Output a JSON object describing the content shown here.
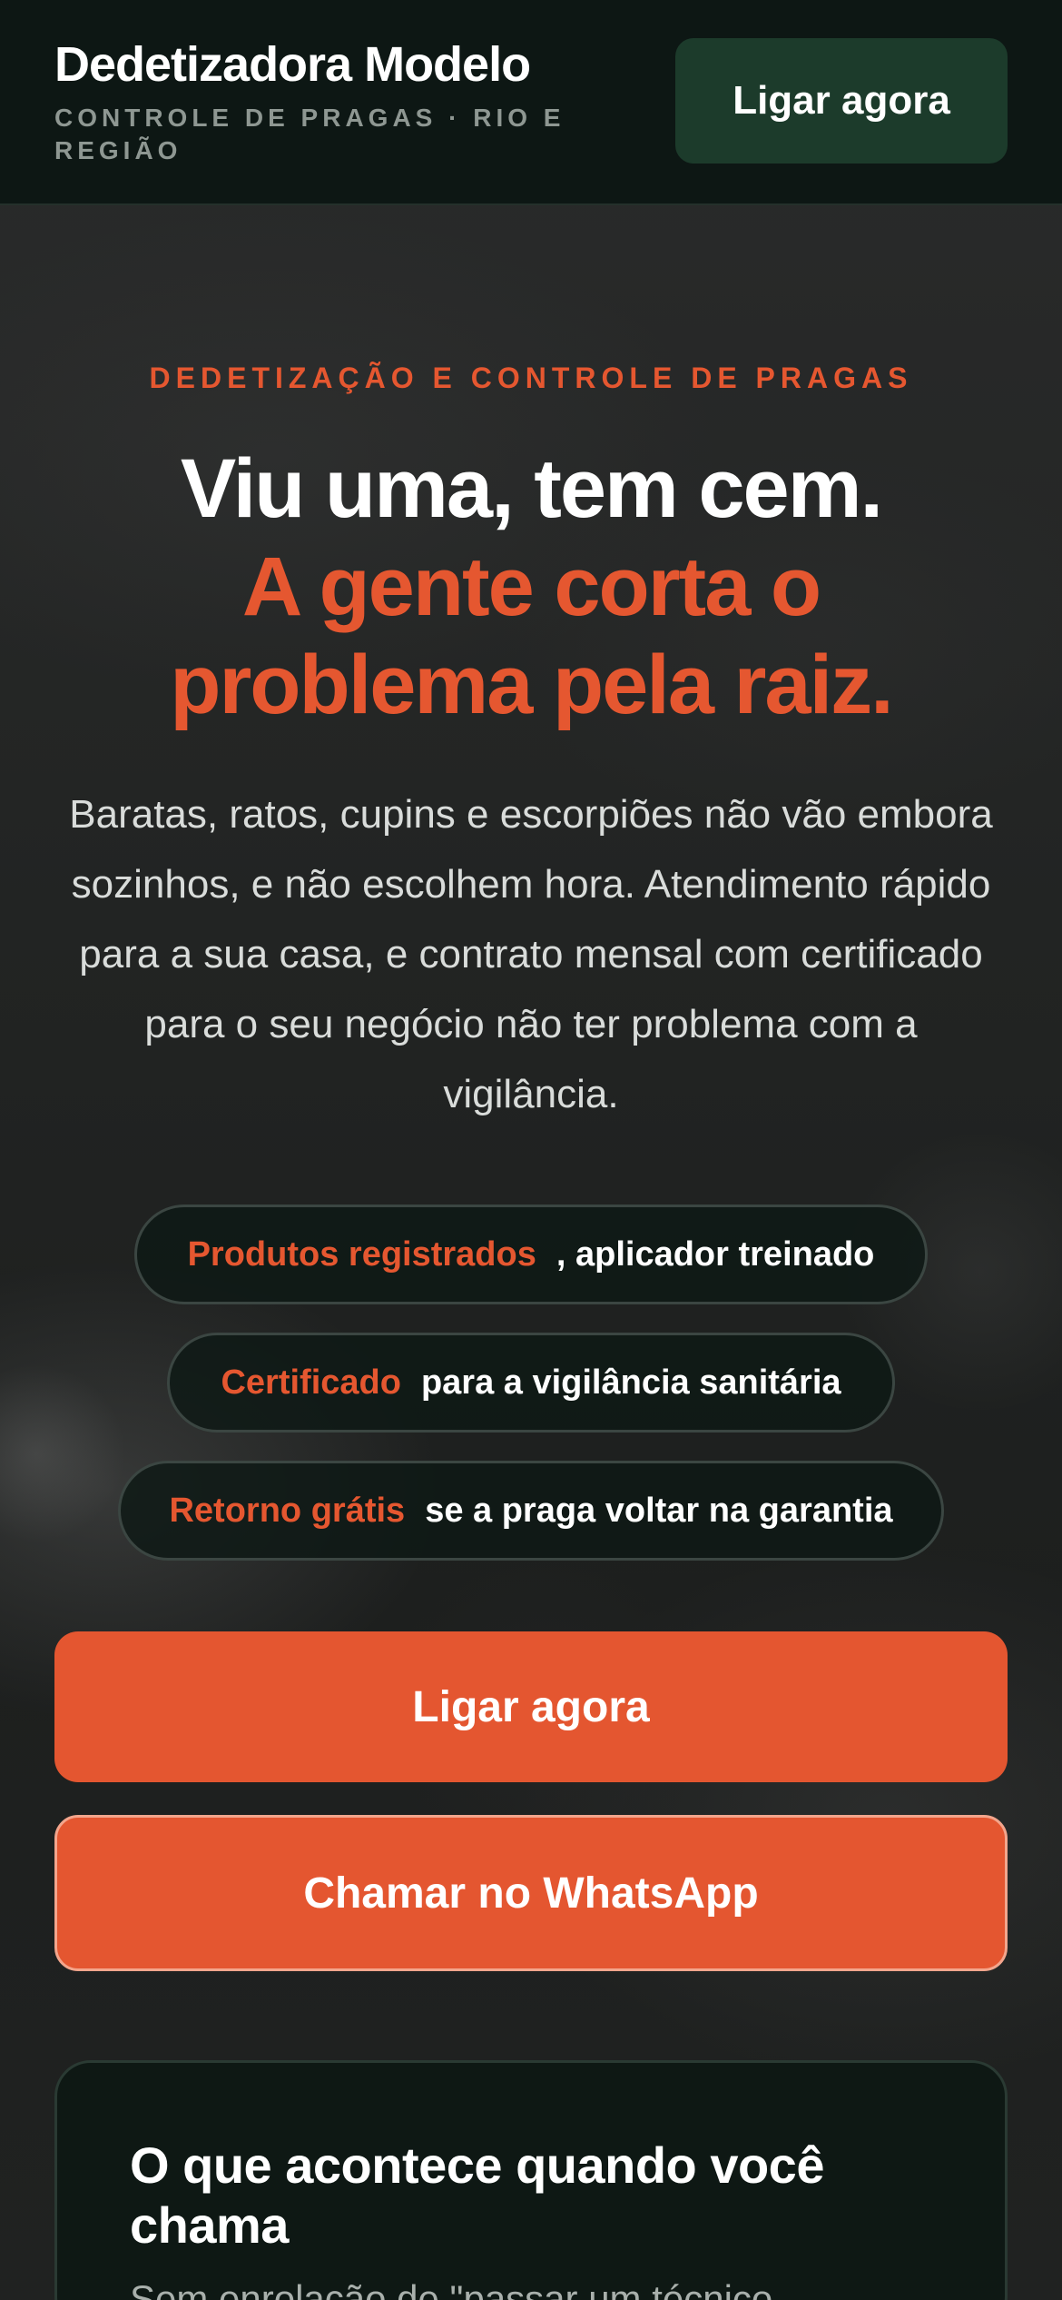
{
  "header": {
    "brand_name": "Dedetizadora Modelo",
    "brand_tagline": "CONTROLE DE PRAGAS · RIO E REGIÃO",
    "call_button": "Ligar agora"
  },
  "hero": {
    "eyebrow": "DEDETIZAÇÃO E CONTROLE DE PRAGAS",
    "headline_line1": "Viu uma, tem cem.",
    "headline_line2": "A gente corta o problema pela raiz.",
    "lede": "Baratas, ratos, cupins e escorpiões não vão embora sozinhos, e não escolhem hora. Atendimento rápido para a sua casa, e contrato mensal com certificado para o seu negócio não ter problema com a vigilância."
  },
  "badges": [
    {
      "highlight": "Produtos registrados",
      "text": ", aplicador treinado"
    },
    {
      "highlight": "Certificado",
      "text": "para a vigilância sanitária"
    },
    {
      "highlight": "Retorno grátis",
      "text": "se a praga voltar na garantia"
    }
  ],
  "cta": {
    "call": "Ligar agora",
    "whatsapp": "Chamar no WhatsApp"
  },
  "process_card": {
    "title": "O que acontece quando você chama",
    "text": "Sem enrolação de \"passar um técnico"
  },
  "colors": {
    "accent": "#e55730",
    "header_bg": "#0d1714",
    "header_button_bg": "#1c3b2b",
    "card_bg": "#0e1814"
  }
}
